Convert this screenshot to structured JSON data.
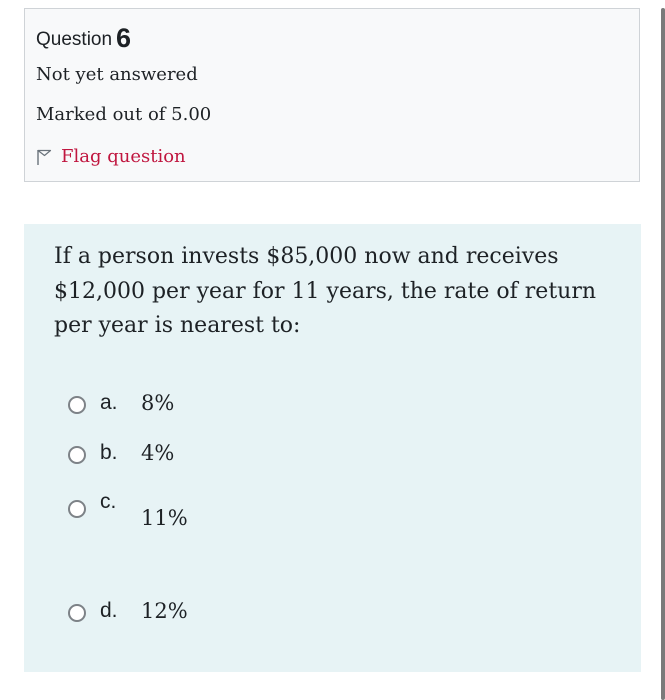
{
  "question_info": {
    "label": "Question",
    "number": "6",
    "state": "Not yet answered",
    "grade": "Marked out of 5.00",
    "flag_label": "Flag question",
    "flag_color": "#c0163f"
  },
  "question": {
    "text": "If a person invests $85,000 now and receives $12,000 per year for 11 years, the rate of return per year is nearest to:",
    "options": [
      {
        "letter": "a.",
        "text": "8%"
      },
      {
        "letter": "b.",
        "text": "4%"
      },
      {
        "letter": "c.",
        "text": "11%"
      },
      {
        "letter": "d.",
        "text": "12%"
      }
    ]
  },
  "colors": {
    "info_background": "#f8f9fa",
    "content_background": "#e7f3f5"
  }
}
